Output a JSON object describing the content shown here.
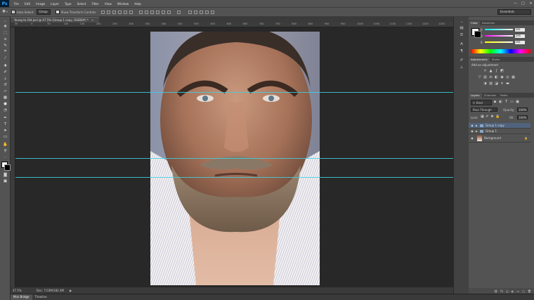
{
  "app": {
    "logo": "Ps"
  },
  "menu": [
    "File",
    "Edit",
    "Image",
    "Layer",
    "Type",
    "Select",
    "Filter",
    "View",
    "Window",
    "Help"
  ],
  "window_controls": [
    "—",
    "□",
    "✕"
  ],
  "options_bar": {
    "auto_select_label": "Auto-Select:",
    "auto_select_value": "Group",
    "show_transform_label": "Show Transform Controls",
    "workspace": "Essentials"
  },
  "document": {
    "tab_title": "Young to Old.psd @ 47.5% (Group 1 copy, RGB/8#) *",
    "zoom": "47.5%",
    "doc_info": "Doc: 7.03M/182.4M"
  },
  "ruler_ticks": [
    "50",
    "0",
    "50",
    "100",
    "150",
    "200",
    "250",
    "300",
    "350",
    "400",
    "450",
    "500",
    "550",
    "600",
    "650",
    "700",
    "750",
    "800",
    "850",
    "900",
    "950",
    "1000",
    "1050",
    "1100",
    "1150",
    "1200",
    "1250"
  ],
  "bottom_tabs": [
    "Mini Bridge",
    "Timeline"
  ],
  "color_panel": {
    "tabs": [
      "Color",
      "Swatches"
    ],
    "channels": [
      {
        "label": "R",
        "value": "255"
      },
      {
        "label": "G",
        "value": "255"
      },
      {
        "label": "B",
        "value": "255"
      }
    ]
  },
  "adjustments_panel": {
    "tabs": [
      "Adjustments",
      "Styles"
    ],
    "heading": "Add an adjustment"
  },
  "layers_panel": {
    "tabs": [
      "Layers",
      "Channels",
      "Paths"
    ],
    "filter_kind": "Kind",
    "blend_mode": "Pass Through",
    "opacity_label": "Opacity:",
    "opacity_value": "100%",
    "lock_label": "Lock:",
    "fill_label": "Fill:",
    "fill_value": "100%",
    "layers": [
      {
        "name": "Group 1 copy",
        "type": "group",
        "selected": true
      },
      {
        "name": "Group 1",
        "type": "group",
        "selected": false
      },
      {
        "name": "Background",
        "type": "pixel",
        "selected": false
      }
    ]
  },
  "colors": {
    "accent_guide": "#3fd0e0",
    "selected_layer": "#4f637d"
  }
}
